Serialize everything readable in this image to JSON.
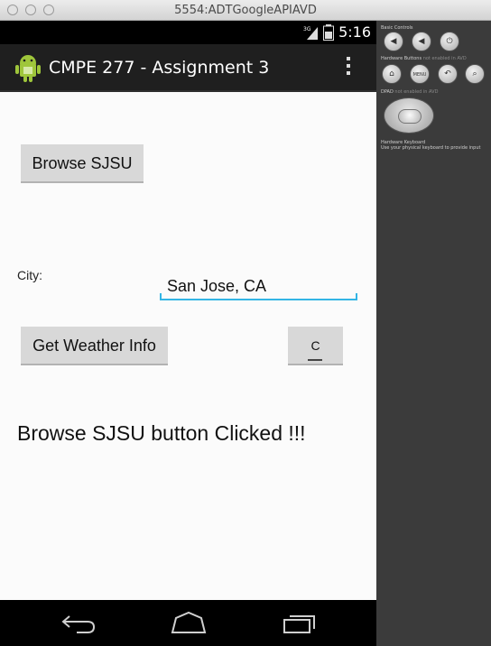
{
  "window": {
    "title": "5554:ADTGoogleAPIAVD"
  },
  "status_bar": {
    "network": "3G",
    "time": "5:16"
  },
  "action_bar": {
    "title": "CMPE 277 - Assignment 3"
  },
  "main": {
    "browse_button": "Browse SJSU",
    "city_label": "City:",
    "city_input_value": "San Jose, CA",
    "weather_button": "Get Weather Info",
    "unit_button": "C",
    "message": "Browse SJSU button Clicked !!!"
  },
  "side_panel": {
    "basic_controls": "Basic Controls",
    "hardware_buttons": "Hardware Buttons",
    "hardware_buttons_note": "not enabled in AVD",
    "menu_label": "MENU",
    "dpad": "DPAD",
    "dpad_note": "not enabled in AVD",
    "hardware_keyboard": "Hardware Keyboard",
    "hardware_keyboard_note": "Use your physical keyboard to provide input"
  },
  "colors": {
    "accent": "#33b5e5",
    "action_bar": "#1f1f1f",
    "android_green": "#9fc63b"
  }
}
